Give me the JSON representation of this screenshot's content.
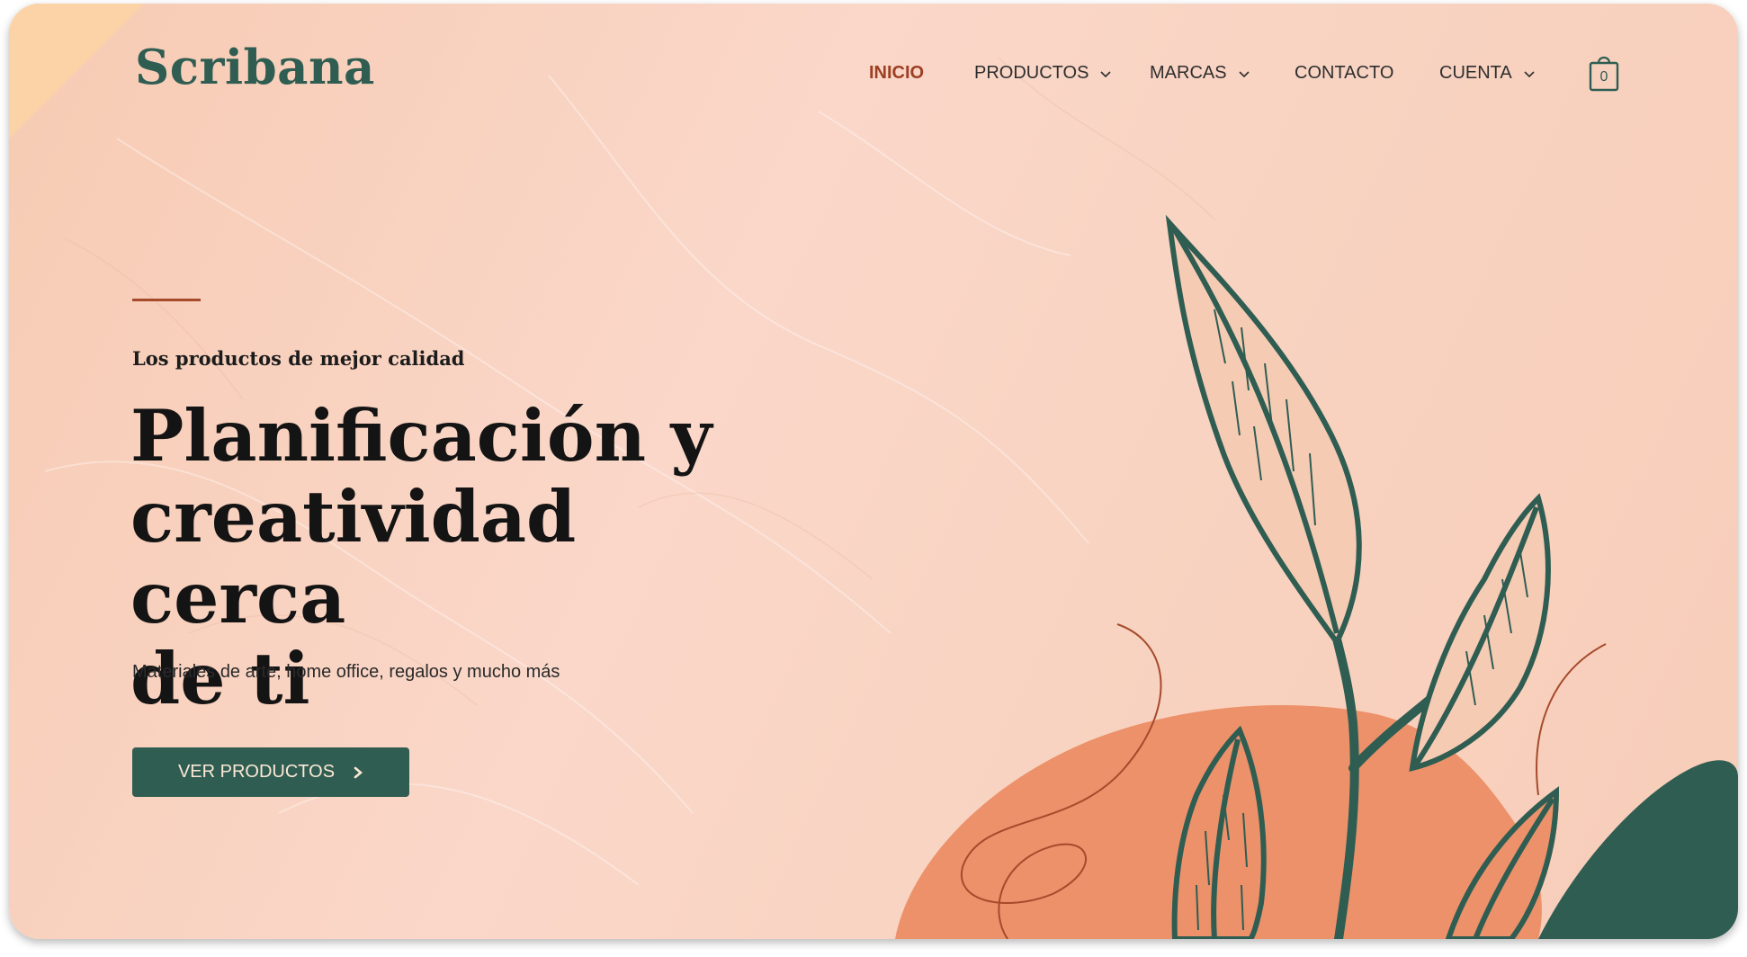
{
  "brand": {
    "logo": "Scribana"
  },
  "nav": {
    "items": [
      {
        "label": "INICIO",
        "active": true,
        "has_dropdown": false
      },
      {
        "label": "PRODUCTOS",
        "active": false,
        "has_dropdown": true
      },
      {
        "label": "MARCAS",
        "active": false,
        "has_dropdown": true
      },
      {
        "label": "CONTACTO",
        "active": false,
        "has_dropdown": false
      },
      {
        "label": "CUENTA",
        "active": false,
        "has_dropdown": true
      }
    ],
    "cart": {
      "icon": "shopping-bag-icon",
      "count": "0"
    }
  },
  "hero": {
    "eyebrow": "Los productos de mejor calidad",
    "headline_lines": [
      "Planificación y",
      "creatividad cerca",
      "de ti"
    ],
    "subtitle": "Materiales de arte, home office, regalos y mucho más",
    "cta_label": "VER PRODUCTOS",
    "cta_icon": "chevron-right-icon"
  },
  "colors": {
    "background_peach": "#f9d4c3",
    "brand_green": "#2f5d52",
    "accent_rust": "#9c3f22",
    "blob_orange": "#ec916a",
    "corner_accent": "#fcd3a6",
    "cta_text": "#fbe9d6"
  },
  "illustration": {
    "name": "botanical-leaves-illustration"
  }
}
